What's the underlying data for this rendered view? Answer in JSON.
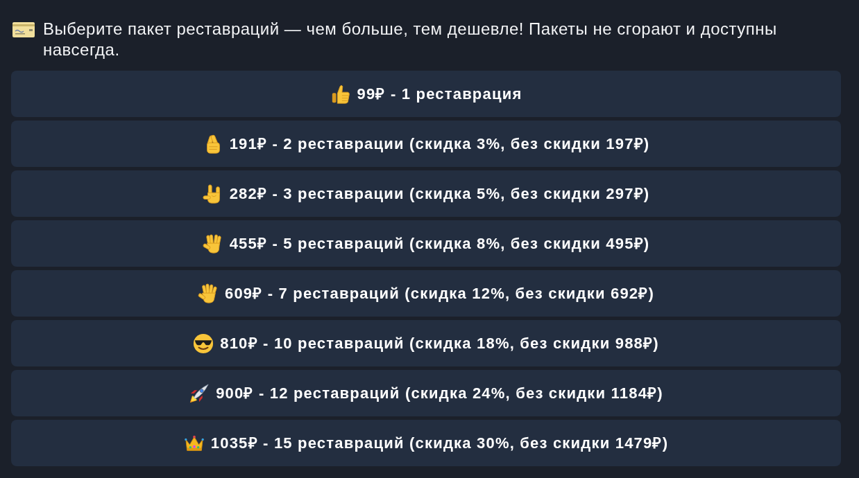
{
  "message": {
    "text": "Выберите пакет реставраций — чем больше, тем дешевле! Пакеты не сгорают и доступны навсегда."
  },
  "packages": [
    {
      "label": "99₽ - 1 реставрация"
    },
    {
      "label": "191₽ - 2 реставрации (скидка 3%, без скидки 197₽)"
    },
    {
      "label": "282₽ - 3 реставрации (скидка 5%, без скидки 297₽)"
    },
    {
      "label": "455₽ - 5 реставраций (скидка 8%, без скидки 495₽)"
    },
    {
      "label": "609₽ - 7 реставраций (скидка 12%, без скидки 692₽)"
    },
    {
      "label": "810₽ - 10 реставраций (скидка 18%, без скидки 988₽)"
    },
    {
      "label": "900₽ - 12 реставраций (скидка 24%, без скидки 1184₽)"
    },
    {
      "label": "1035₽ - 15 реставраций (скидка 30%, без скидки 1479₽)"
    }
  ]
}
